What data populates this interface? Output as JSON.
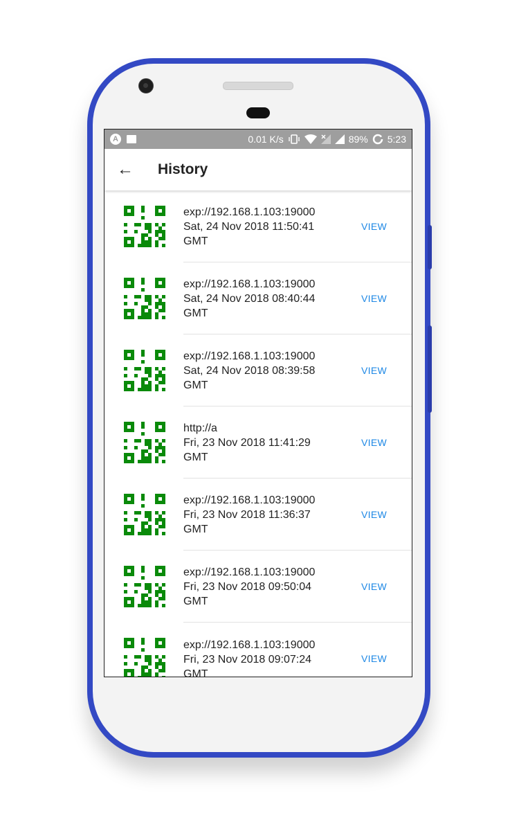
{
  "statusbar": {
    "network_speed": "0.01 K/s",
    "battery": "89%",
    "time": "5:23",
    "app_icon": "A"
  },
  "appbar": {
    "back_icon": "←",
    "title": "History"
  },
  "history": [
    {
      "url": "exp://192.168.1.103:19000",
      "date": "Sat, 24 Nov 2018 11:50:41",
      "tz": "GMT",
      "action": "VIEW"
    },
    {
      "url": "exp://192.168.1.103:19000",
      "date": "Sat, 24 Nov 2018 08:40:44",
      "tz": "GMT",
      "action": "VIEW"
    },
    {
      "url": "exp://192.168.1.103:19000",
      "date": "Sat, 24 Nov 2018 08:39:58",
      "tz": "GMT",
      "action": "VIEW"
    },
    {
      "url": "http://a",
      "date": "Fri, 23 Nov 2018 11:41:29",
      "tz": "GMT",
      "action": "VIEW"
    },
    {
      "url": "exp://192.168.1.103:19000",
      "date": "Fri, 23 Nov 2018 11:36:37",
      "tz": "GMT",
      "action": "VIEW"
    },
    {
      "url": "exp://192.168.1.103:19000",
      "date": "Fri, 23 Nov 2018 09:50:04",
      "tz": "GMT",
      "action": "VIEW"
    },
    {
      "url": "exp://192.168.1.103:19000",
      "date": "Fri, 23 Nov 2018 09:07:24",
      "tz": "GMT",
      "action": "VIEW"
    }
  ],
  "colors": {
    "phone_frame": "#3349c4",
    "qr_green": "#0a8a0a",
    "view_blue": "#1e88e5",
    "statusbar": "#9e9e9e"
  }
}
